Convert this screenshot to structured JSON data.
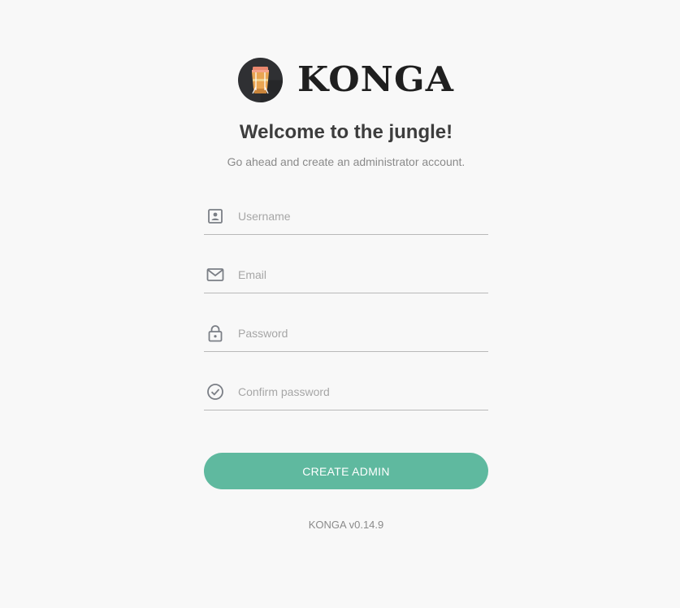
{
  "brand": {
    "name": "KONGA",
    "logo_icon": "conga-drum-icon"
  },
  "heading": {
    "title": "Welcome to the jungle!",
    "subtitle": "Go ahead and create an administrator account."
  },
  "form": {
    "username": {
      "placeholder": "Username",
      "value": "",
      "icon": "user-card-icon"
    },
    "email": {
      "placeholder": "Email",
      "value": "",
      "icon": "envelope-icon"
    },
    "password": {
      "placeholder": "Password",
      "value": "",
      "icon": "lock-icon"
    },
    "confirm_password": {
      "placeholder": "Confirm password",
      "value": "",
      "icon": "check-circle-icon"
    },
    "submit_label": "CREATE ADMIN"
  },
  "footer": {
    "version": "KONGA v0.14.9"
  },
  "colors": {
    "background": "#f8f8f8",
    "accent": "#5fb99f",
    "text": "#3d3d3d",
    "muted": "#8a8a8a",
    "icon": "#7b7f86"
  }
}
